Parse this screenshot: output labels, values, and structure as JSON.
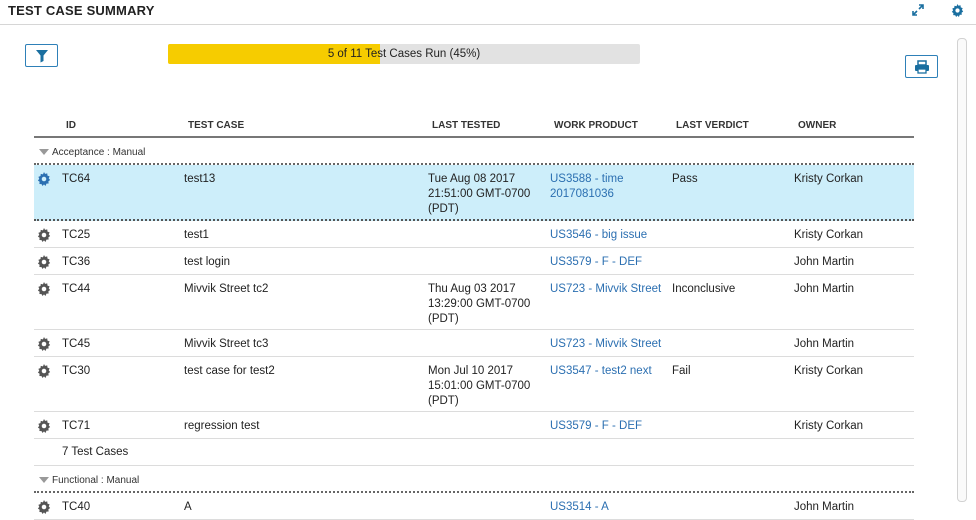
{
  "header": {
    "title": "TEST CASE SUMMARY",
    "expand_icon": "expand-icon",
    "settings_icon": "gear-icon"
  },
  "toolbar": {
    "filter_icon": "filter-icon",
    "print_icon": "print-icon"
  },
  "progress": {
    "label": "5 of 11 Test Cases Run (45%)",
    "fraction": 0.45,
    "color": "#f6cc00"
  },
  "table": {
    "columns": [
      "ID",
      "TEST CASE",
      "LAST TESTED",
      "WORK PRODUCT",
      "LAST VERDICT",
      "OWNER"
    ],
    "groups": [
      {
        "label": "Acceptance : Manual",
        "rows": [
          {
            "id": "TC64",
            "name": "test13",
            "tested": [
              "Tue Aug 08 2017",
              "21:51:00 GMT-0700",
              "(PDT)"
            ],
            "work": [
              "US3588 - time",
              "2017081036"
            ],
            "verdict": "Pass",
            "owner": "Kristy Corkan",
            "selected": true
          },
          {
            "id": "TC25",
            "name": "test1",
            "tested": [],
            "work": [
              "US3546 - big issue"
            ],
            "verdict": "",
            "owner": "Kristy Corkan",
            "selected": false
          },
          {
            "id": "TC36",
            "name": "test login",
            "tested": [],
            "work": [
              "US3579 - F - DEF"
            ],
            "verdict": "",
            "owner": "John Martin",
            "selected": false
          },
          {
            "id": "TC44",
            "name": "Mivvik Street tc2",
            "tested": [
              "Thu Aug 03 2017",
              "13:29:00 GMT-0700",
              "(PDT)"
            ],
            "work": [
              "US723 - Mivvik Street"
            ],
            "verdict": "Inconclusive",
            "owner": "John Martin",
            "selected": false
          },
          {
            "id": "TC45",
            "name": "Mivvik Street tc3",
            "tested": [],
            "work": [
              "US723 - Mivvik Street"
            ],
            "verdict": "",
            "owner": "John Martin",
            "selected": false
          },
          {
            "id": "TC30",
            "name": "test case for test2",
            "tested": [
              "Mon Jul 10 2017",
              "15:01:00 GMT-0700",
              "(PDT)"
            ],
            "work": [
              "US3547 - test2 next"
            ],
            "verdict": "Fail",
            "owner": "Kristy Corkan",
            "selected": false
          },
          {
            "id": "TC71",
            "name": "regression test",
            "tested": [],
            "work": [
              "US3579 - F - DEF"
            ],
            "verdict": "",
            "owner": "Kristy Corkan",
            "selected": false
          }
        ],
        "footer": "7 Test Cases"
      },
      {
        "label": "Functional : Manual",
        "rows": [
          {
            "id": "TC40",
            "name": "A",
            "tested": [],
            "work": [
              "US3514 - A"
            ],
            "verdict": "",
            "owner": "John Martin",
            "selected": false
          }
        ],
        "footer": ""
      }
    ]
  },
  "colors": {
    "accent": "#2b6fb1",
    "selected_row": "#cdeefa",
    "progress_track": "#e2e2e2"
  }
}
